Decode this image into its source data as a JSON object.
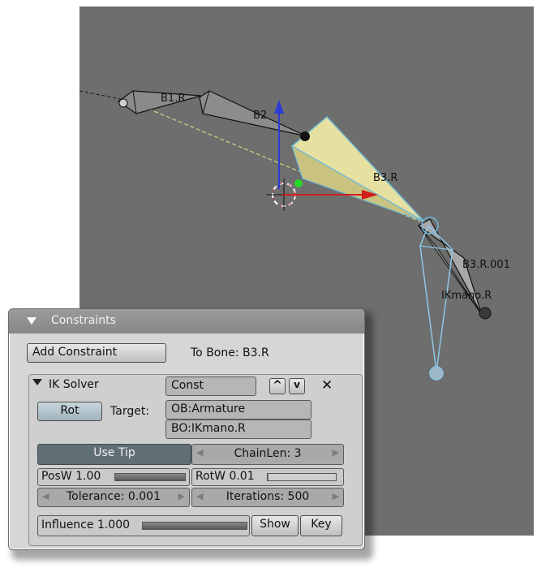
{
  "viewport": {
    "bones": [
      "B1.R",
      "B2",
      "B3.R",
      "B3.R.001",
      "IKmano.R"
    ],
    "colors": {
      "background": "#6e6e6e",
      "selected_bone": "#e6e1a0",
      "ik_chain": "#8ec6e8",
      "x_axis": "#d21d1d",
      "y_axis": "#2d3ad6",
      "z_axis": "#28d828"
    }
  },
  "panel": {
    "title": "Constraints",
    "add_constraint": "Add Constraint",
    "to_bone": "To Bone: B3.R",
    "constraint": {
      "type": "IK Solver",
      "name": "Const",
      "up_arrow": "^",
      "down_arrow": "v",
      "close": "✕",
      "rot_label": "Rot",
      "target_label": "Target:",
      "target_object": "OB:Armature",
      "target_bone": "BO:IKmano.R",
      "use_tip": "Use Tip",
      "chainlen": "ChainLen: 3",
      "posw_label": "PosW 1.00",
      "posw_value": 1.0,
      "rotw_label": "RotW 0.01",
      "rotw_value": 0.01,
      "tolerance": "Tolerance: 0.001",
      "iterations": "Iterations: 500"
    },
    "influence_label": "Influence 1.000",
    "influence_value": 1.0,
    "show": "Show",
    "key": "Key"
  }
}
